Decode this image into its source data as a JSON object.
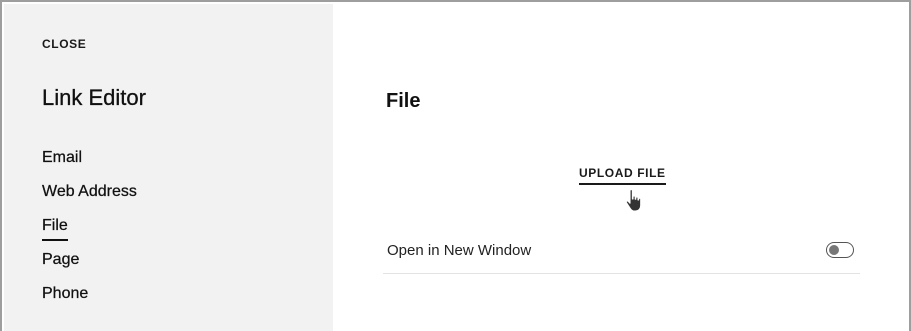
{
  "sidebar": {
    "close_label": "CLOSE",
    "title": "Link Editor",
    "items": [
      {
        "label": "Email",
        "active": false
      },
      {
        "label": "Web Address",
        "active": false
      },
      {
        "label": "File",
        "active": true
      },
      {
        "label": "Page",
        "active": false
      },
      {
        "label": "Phone",
        "active": false
      }
    ]
  },
  "main": {
    "title": "File",
    "upload_label": "UPLOAD FILE",
    "option": {
      "label": "Open in New Window",
      "enabled": false
    }
  },
  "icons": {
    "cursor": "hand-pointer-icon",
    "toggle": "toggle-switch"
  },
  "colors": {
    "sidebar_bg": "#f2f2f2",
    "text": "#111111",
    "divider": "#e3e3e3"
  }
}
